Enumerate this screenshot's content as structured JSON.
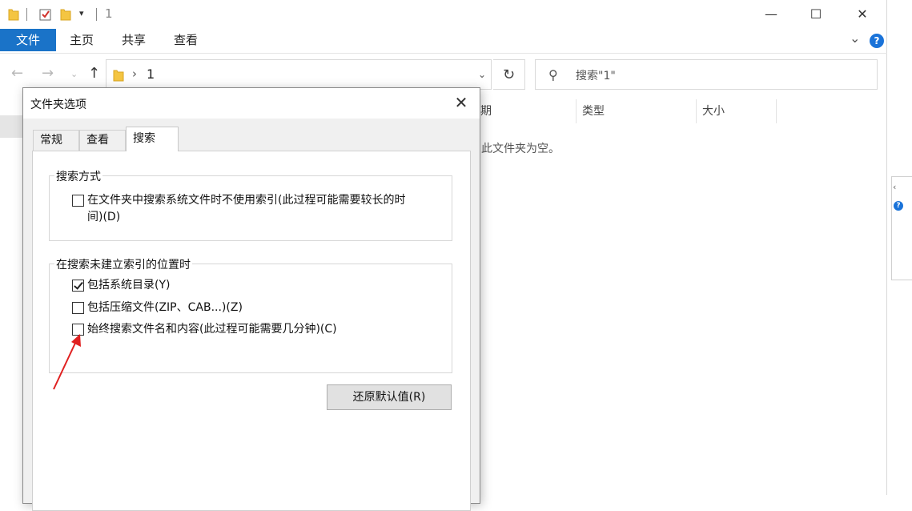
{
  "window": {
    "title": "1",
    "minimize_glyph": "—",
    "maximize_glyph": "☐",
    "close_glyph": "✕"
  },
  "ribbon": {
    "tabs": [
      "文件",
      "主页",
      "共享",
      "查看"
    ],
    "help_glyph": "?",
    "expand_glyph": "⌄"
  },
  "address": {
    "crumb": "1",
    "separator": "›"
  },
  "search": {
    "placeholder": "搜索\"1\""
  },
  "columns": {
    "date_partial": "期",
    "type": "类型",
    "size": "大小"
  },
  "content": {
    "empty_message": "此文件夹为空。"
  },
  "dialog": {
    "title": "文件夹选项",
    "tabs": [
      "常规",
      "查看",
      "搜索"
    ],
    "active_tab": "搜索",
    "group1": {
      "legend": "搜索方式",
      "items": [
        {
          "label_line1": "在文件夹中搜索系统文件时不使用索引(此过程可能需要较长的时",
          "label_line2": "间)(D)",
          "checked": false
        }
      ]
    },
    "group2": {
      "legend": "在搜索未建立索引的位置时",
      "items": [
        {
          "label": "包括系统目录(Y)",
          "checked": true
        },
        {
          "label": "包括压缩文件(ZIP、CAB...)(Z)",
          "checked": false
        },
        {
          "label": "始终搜索文件名和内容(此过程可能需要几分钟)(C)",
          "checked": false
        }
      ]
    },
    "restore_button": "还原默认值(R)"
  },
  "colors": {
    "accent_blue": "#1a73c8",
    "annotation_red": "#e02020"
  }
}
